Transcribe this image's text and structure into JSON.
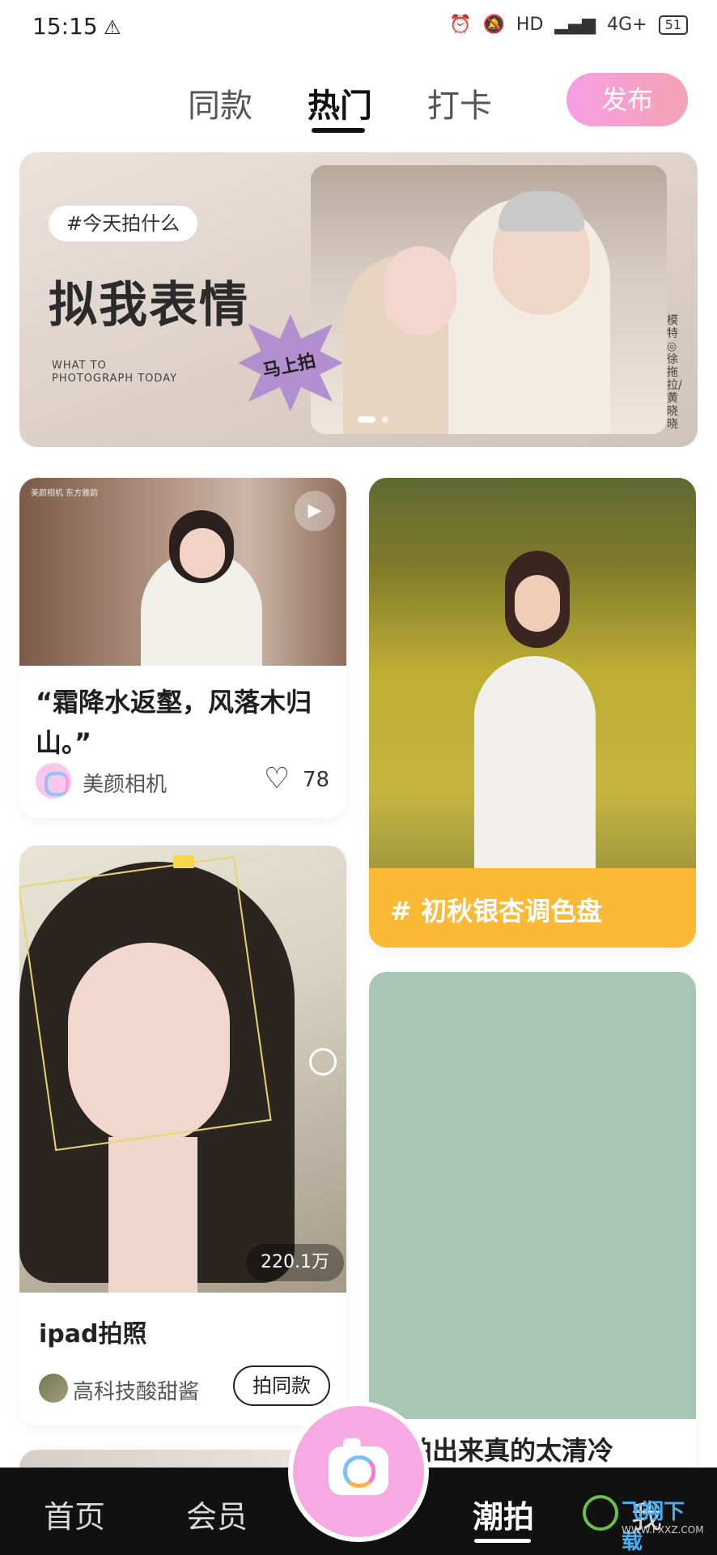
{
  "status_bar": {
    "time": "15:15",
    "warning_icon": "warning-icon",
    "network": "4G+",
    "hd": "HD",
    "battery": "51"
  },
  "top_tabs": {
    "tabs": [
      "同款",
      "热门",
      "打卡"
    ],
    "active": "热门",
    "publish_label": "发布"
  },
  "banner": {
    "tag": "#今天拍什么",
    "headline": "拟我表情",
    "sub_line1": "WHAT TO",
    "sub_line2": "PHOTOGRAPH TODAY",
    "star_label": "马上拍",
    "credit": "模特◎徐拖拉/黄晓晓"
  },
  "feed": {
    "card1": {
      "watermark": "美颜相机 东方雅韵",
      "title": "“霜降水返壑，风落木归山。”",
      "author": "美颜相机",
      "likes": "78"
    },
    "card2": {
      "tag": "# 初秋银杏调色盘"
    },
    "card3": {
      "views": "220.1万",
      "title": "ipad拍照",
      "author": "高科技酸甜酱",
      "same_style_label": "拍同款"
    },
    "card4": {
      "title": "片拍出来真的太清冷"
    }
  },
  "bottom_nav": {
    "items": [
      "首页",
      "会员",
      "潮拍",
      "我"
    ],
    "active": "潮拍"
  },
  "watermark": {
    "text": "飞翔下载",
    "url": "WWW.FXXZ.COM"
  },
  "colors": {
    "accent_pink": "#f69ee5",
    "card2_bg": "#fbb935",
    "card4_bg": "#a8c6b4",
    "nav_bg": "#111111"
  }
}
